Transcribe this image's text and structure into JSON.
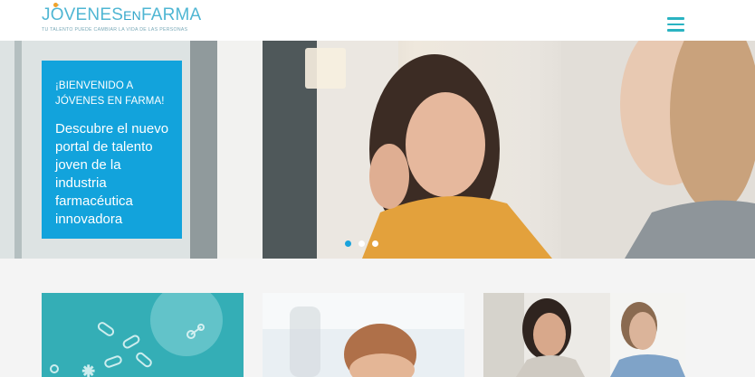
{
  "header": {
    "logo_part1": "JÓVENES",
    "logo_part2": "EN",
    "logo_part3": "FARMA",
    "tagline": "TU TALENTO PUEDE CAMBIAR LA VIDA DE LAS PERSONAS",
    "menu_icon": "hamburger-menu-icon"
  },
  "hero": {
    "kicker": "¡Bienvenido a Jóvenes en Farma!",
    "text": "Descubre el nuevo portal de talento joven de la industria farmacéutica innovadora",
    "box_color": "#12a3dc",
    "slides": 3,
    "active_slide": 1
  },
  "colors": {
    "brand": "#4fb6d3",
    "accent": "#12a3dc",
    "menu": "#2ab3c2"
  }
}
